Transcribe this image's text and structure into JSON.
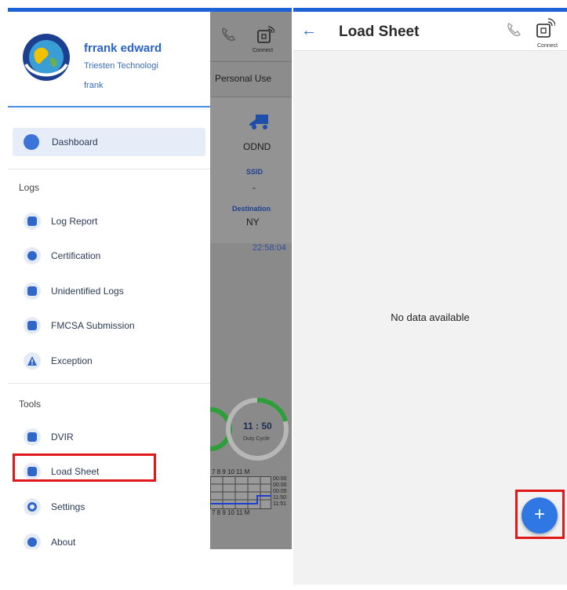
{
  "left": {
    "background": {
      "personal_use": "Personal Use",
      "connect_label": "Connect",
      "vehicle_status": "ODND",
      "ssid_label": "SSID",
      "ssid_value": "-",
      "destination_label": "Destination",
      "destination_value": "NY",
      "time": "22:58:04",
      "duty_cycle_time": "11 : 50",
      "duty_cycle_label": "Duty Cycle",
      "grid_hours_top": "7 8 9 10 11 M",
      "grid_hours_bottom": "7 8 9 10 11 M",
      "grid_totals": [
        "00:00",
        "00:00",
        "00:00",
        "11:50",
        "11:51"
      ]
    },
    "drawer": {
      "user_name": "frrank edward",
      "company": "Triesten Technologi",
      "handle": "frank",
      "dashboard_label": "Dashboard",
      "logs_section": "Logs",
      "logs_items": [
        "Log Report",
        "Certification",
        "Unidentified Logs",
        "FMCSA Submission",
        "Exception"
      ],
      "tools_section": "Tools",
      "tools_items": [
        "DVIR",
        "Load Sheet",
        "Settings",
        "About"
      ]
    }
  },
  "right": {
    "title": "Load Sheet",
    "connect_label": "Connect",
    "empty_message": "No data available",
    "fab_symbol": "+"
  },
  "colors": {
    "primary": "#1c63d8",
    "highlight": "#e01818",
    "fab": "#2f78e4"
  }
}
